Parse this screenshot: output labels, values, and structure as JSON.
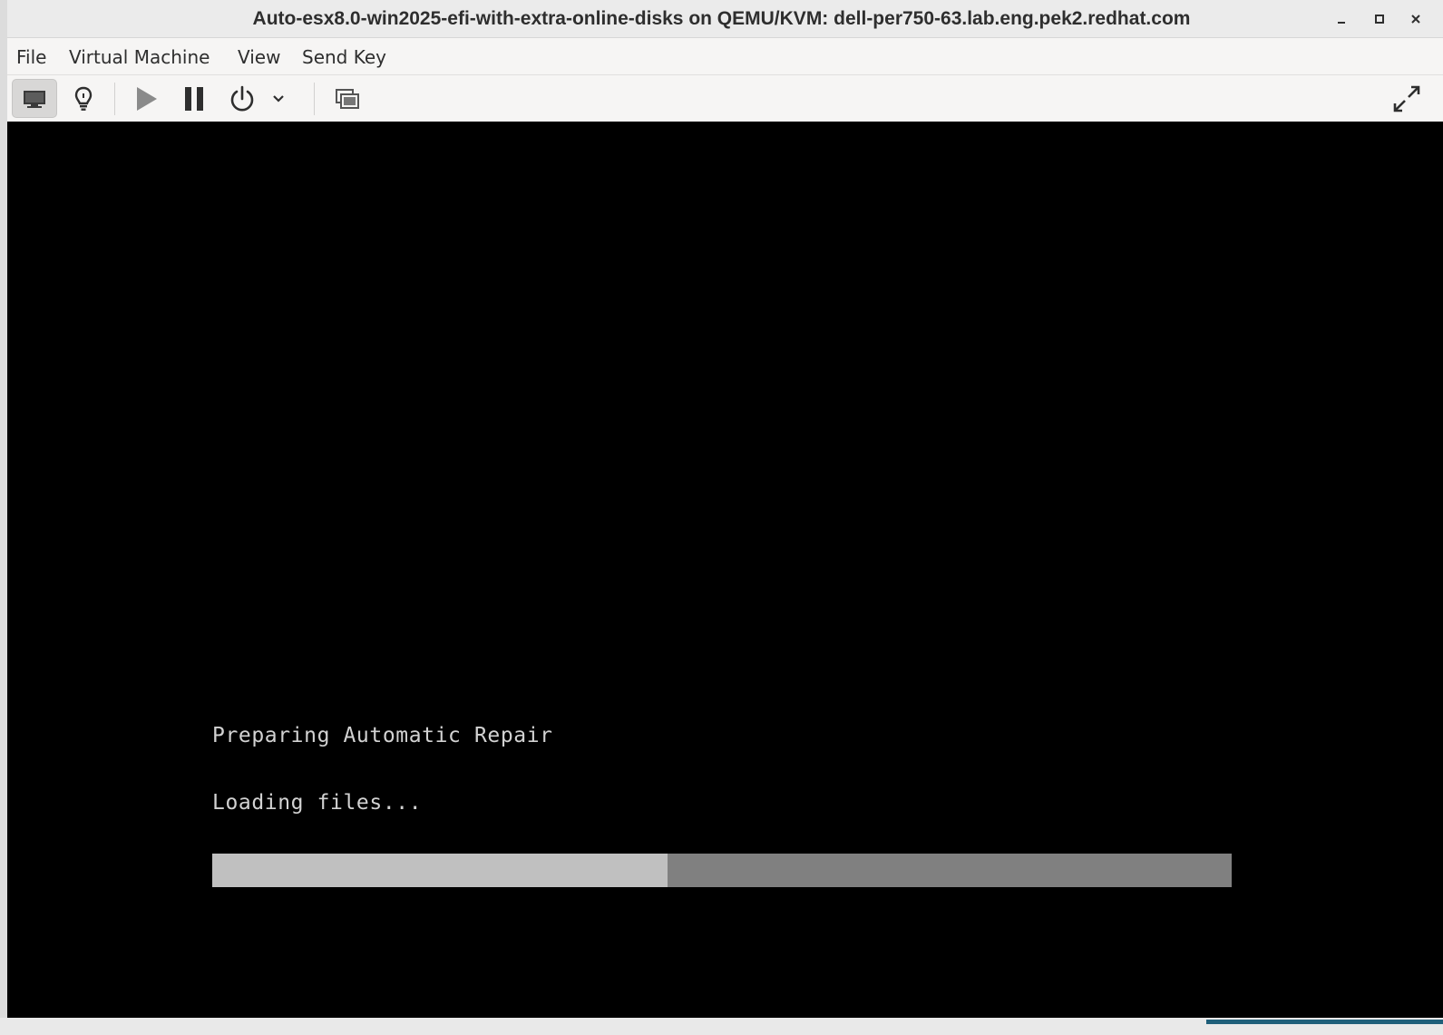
{
  "window": {
    "title": "Auto-esx8.0-win2025-efi-with-extra-online-disks on QEMU/KVM: dell-per750-63.lab.eng.pek2.redhat.com",
    "controls": [
      "minimize-icon",
      "maximize-icon",
      "close-icon"
    ]
  },
  "menubar": {
    "items": [
      {
        "label": "File"
      },
      {
        "label": "Virtual Machine"
      },
      {
        "label": "View"
      },
      {
        "label": "Send Key"
      }
    ]
  },
  "toolbar": {
    "buttons": [
      {
        "icon": "monitor-icon",
        "active": true
      },
      {
        "icon": "lightbulb-icon",
        "active": false
      },
      {
        "icon": "play-icon",
        "active": false
      },
      {
        "icon": "pause-icon",
        "active": false
      },
      {
        "icon": "power-icon",
        "active": false
      },
      {
        "icon": "chevron-down-icon",
        "active": false
      },
      {
        "icon": "snapshots-icon",
        "active": false
      },
      {
        "icon": "fullscreen-icon",
        "active": false
      }
    ]
  },
  "console": {
    "line1": "Preparing Automatic Repair",
    "line2": "Loading files...",
    "progress_fraction": 0.447,
    "colors": {
      "background": "#000000",
      "text": "#d2d2d2",
      "progress_fill": "#c0c0c0",
      "progress_track": "#808080"
    }
  }
}
